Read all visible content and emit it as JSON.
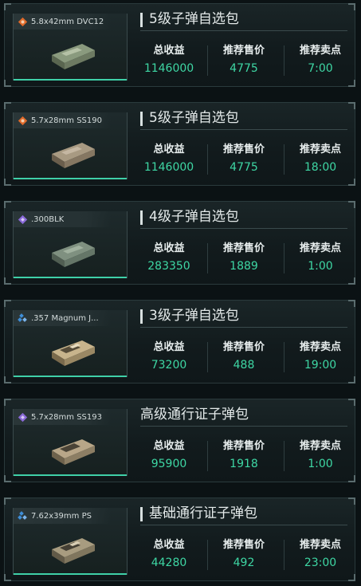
{
  "colors": {
    "accent_green": "#3ed7a4",
    "tier_orange": "#e06a2a",
    "tier_purple": "#8a6ad8",
    "tier_blue": "#3e8ed8"
  },
  "cards": [
    {
      "ammo_name": "5.8x42mm DVC12",
      "tier_icon": "orange-diamond-icon",
      "pack_title": "5级子弹自选包",
      "stats": [
        {
          "label": "总收益",
          "value": "1146000"
        },
        {
          "label": "推荐售价",
          "value": "4775"
        },
        {
          "label": "推荐卖点",
          "value": "7:00"
        }
      ]
    },
    {
      "ammo_name": "5.7x28mm SS190",
      "tier_icon": "orange-diamond-icon",
      "pack_title": "5级子弹自选包",
      "stats": [
        {
          "label": "总收益",
          "value": "1146000"
        },
        {
          "label": "推荐售价",
          "value": "4775"
        },
        {
          "label": "推荐卖点",
          "value": "18:00"
        }
      ]
    },
    {
      "ammo_name": ".300BLK",
      "tier_icon": "purple-diamond-icon",
      "pack_title": "4级子弹自选包",
      "stats": [
        {
          "label": "总收益",
          "value": "283350"
        },
        {
          "label": "推荐售价",
          "value": "1889"
        },
        {
          "label": "推荐卖点",
          "value": "1:00"
        }
      ]
    },
    {
      "ammo_name": ".357 Magnum J...",
      "tier_icon": "blue-diamond-icon",
      "pack_title": "3级子弹自选包",
      "stats": [
        {
          "label": "总收益",
          "value": "73200"
        },
        {
          "label": "推荐售价",
          "value": "488"
        },
        {
          "label": "推荐卖点",
          "value": "19:00"
        }
      ]
    },
    {
      "ammo_name": "5.7x28mm SS193",
      "tier_icon": "purple-diamond-icon",
      "pack_title": "高级通行证子弹包",
      "stats": [
        {
          "label": "总收益",
          "value": "95900"
        },
        {
          "label": "推荐售价",
          "value": "1918"
        },
        {
          "label": "推荐卖点",
          "value": "1:00"
        }
      ]
    },
    {
      "ammo_name": "7.62x39mm PS",
      "tier_icon": "blue-diamond-icon",
      "pack_title": "基础通行证子弹包",
      "stats": [
        {
          "label": "总收益",
          "value": "44280"
        },
        {
          "label": "推荐售价",
          "value": "492"
        },
        {
          "label": "推荐卖点",
          "value": "23:00"
        }
      ]
    }
  ]
}
